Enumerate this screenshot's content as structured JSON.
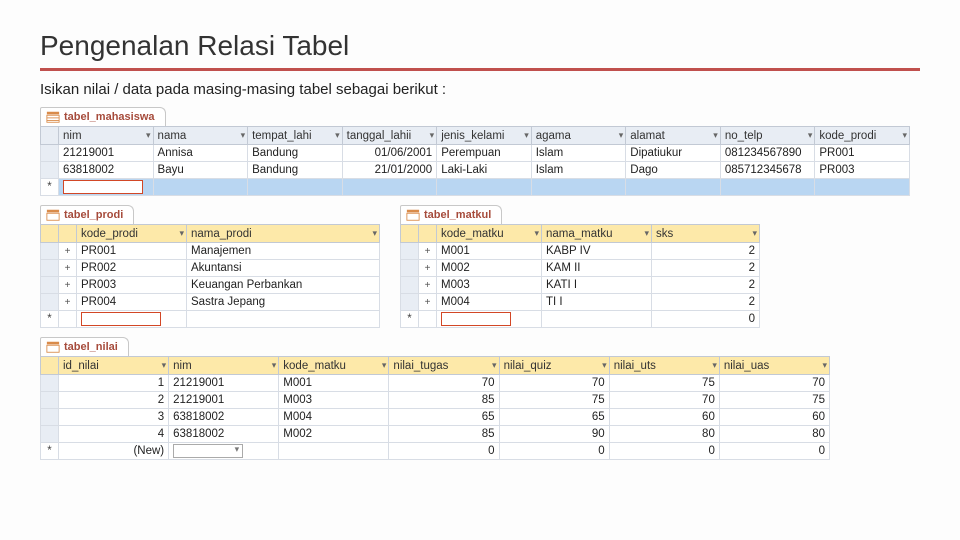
{
  "page": {
    "title": "Pengenalan Relasi Tabel",
    "subtitle": "Isikan nilai / data pada masing-masing tabel sebagai berikut :"
  },
  "tabs": {
    "mahasiswa": "tabel_mahasiswa",
    "prodi": "tabel_prodi",
    "matkul": "tabel_matkul",
    "nilai": "tabel_nilai"
  },
  "mahasiswa": {
    "cols": [
      "nim",
      "nama",
      "tempat_lahi",
      "tanggal_lahii",
      "jenis_kelami",
      "agama",
      "alamat",
      "no_telp",
      "kode_prodi"
    ],
    "rows": [
      {
        "nim": "21219001",
        "nama": "Annisa",
        "tempat": "Bandung",
        "tgl": "01/06/2001",
        "jk": "Perempuan",
        "agama": "Islam",
        "alamat": "Dipatiukur",
        "telp": "081234567890",
        "kode": "PR001"
      },
      {
        "nim": "63818002",
        "nama": "Bayu",
        "tempat": "Bandung",
        "tgl": "21/01/2000",
        "jk": "Laki-Laki",
        "agama": "Islam",
        "alamat": "Dago",
        "telp": "085712345678",
        "kode": "PR003"
      }
    ]
  },
  "prodi": {
    "cols": [
      "kode_prodi",
      "nama_prodi"
    ],
    "rows": [
      {
        "kode": "PR001",
        "nama": "Manajemen"
      },
      {
        "kode": "PR002",
        "nama": "Akuntansi"
      },
      {
        "kode": "PR003",
        "nama": "Keuangan Perbankan"
      },
      {
        "kode": "PR004",
        "nama": "Sastra Jepang"
      }
    ]
  },
  "matkul": {
    "cols": [
      "kode_matku",
      "nama_matku",
      "sks"
    ],
    "rows": [
      {
        "kode": "M001",
        "nama": "KABP IV",
        "sks": "2"
      },
      {
        "kode": "M002",
        "nama": "KAM II",
        "sks": "2"
      },
      {
        "kode": "M003",
        "nama": "KATI I",
        "sks": "2"
      },
      {
        "kode": "M004",
        "nama": "TI I",
        "sks": "2"
      }
    ],
    "new_sks": "0"
  },
  "nilai": {
    "cols": [
      "id_nilai",
      "nim",
      "kode_matku",
      "nilai_tugas",
      "nilai_quiz",
      "nilai_uts",
      "nilai_uas"
    ],
    "rows": [
      {
        "id": "1",
        "nim": "21219001",
        "kode": "M001",
        "tugas": "70",
        "quiz": "70",
        "uts": "75",
        "uas": "70"
      },
      {
        "id": "2",
        "nim": "21219001",
        "kode": "M003",
        "tugas": "85",
        "quiz": "75",
        "uts": "70",
        "uas": "75"
      },
      {
        "id": "3",
        "nim": "63818002",
        "kode": "M004",
        "tugas": "65",
        "quiz": "65",
        "uts": "60",
        "uas": "60"
      },
      {
        "id": "4",
        "nim": "63818002",
        "kode": "M002",
        "tugas": "85",
        "quiz": "90",
        "uts": "80",
        "uas": "80"
      }
    ],
    "new": {
      "id": "(New)",
      "tugas": "0",
      "quiz": "0",
      "uts": "0",
      "uas": "0"
    }
  }
}
